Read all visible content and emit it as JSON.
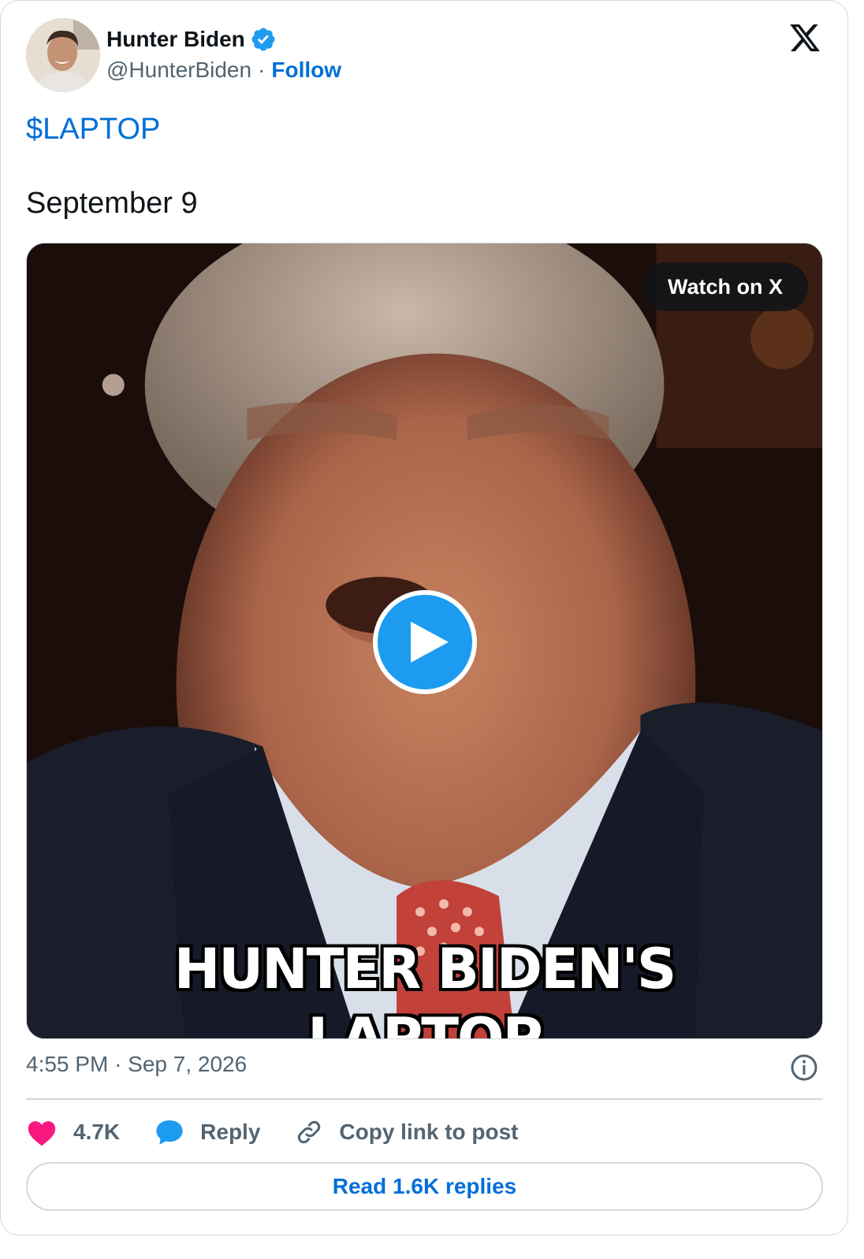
{
  "author": {
    "display_name": "Hunter Biden",
    "handle": "@HunterBiden",
    "separator": "·",
    "follow_label": "Follow"
  },
  "post": {
    "cashtag": "$LAPTOP",
    "body": "September 9"
  },
  "media": {
    "watch_label": "Watch on X",
    "caption_line1": "HUNTER BIDEN'S",
    "caption_line2": "LAPTOP"
  },
  "meta": {
    "time": "4:55 PM",
    "separator": "·",
    "date": "Sep 7, 2026"
  },
  "actions": {
    "likes": "4.7K",
    "reply_label": "Reply",
    "copy_label": "Copy link to post"
  },
  "replies_label": "Read 1.6K replies",
  "colors": {
    "accent": "#1d9bf0",
    "link": "#006fd6",
    "like": "#f91880",
    "muted": "#536471"
  }
}
